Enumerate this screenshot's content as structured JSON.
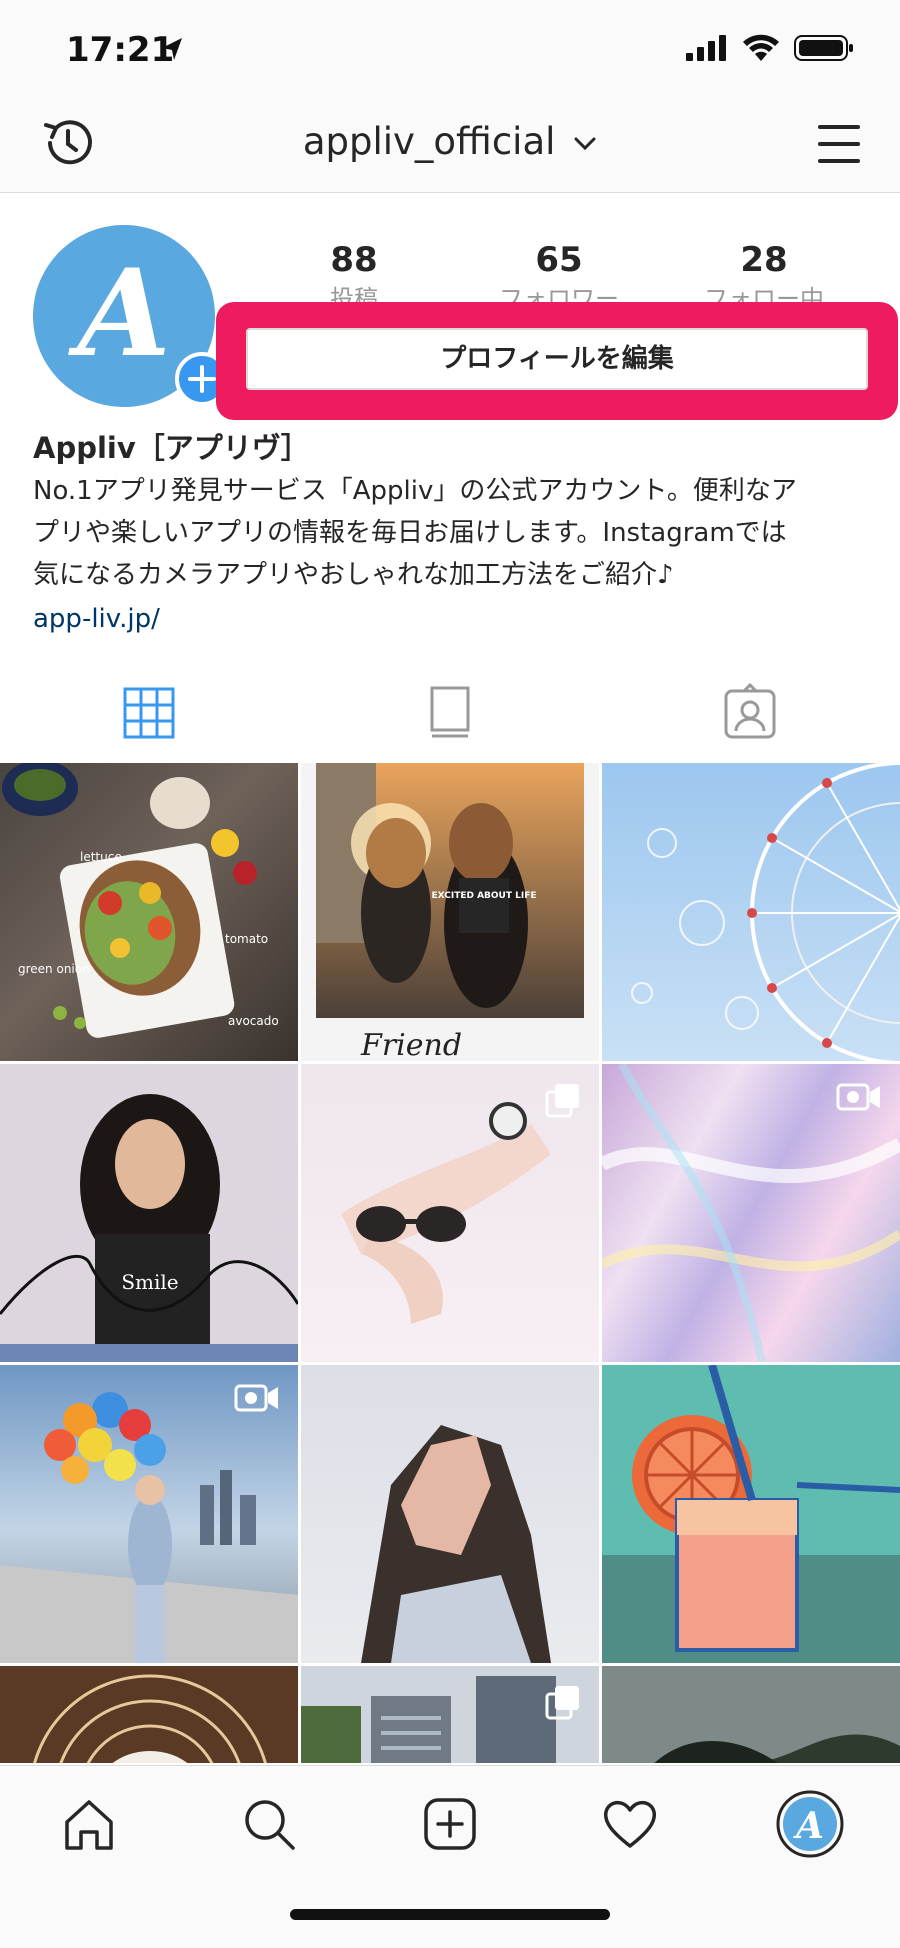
{
  "status_bar": {
    "time": "17:21"
  },
  "nav": {
    "username": "appliv_official"
  },
  "profile": {
    "avatar_letter": "A",
    "stats": [
      {
        "count": "88",
        "label": "投稿"
      },
      {
        "count": "65",
        "label": "フォロワー"
      },
      {
        "count": "28",
        "label": "フォロー中"
      }
    ],
    "edit_button_label": "プロフィールを編集",
    "highlight_color": "#ee1c5f",
    "name": "Appliv［アプリヴ］",
    "bio_lines": [
      "No.1アプリ発見サービス「Appliv」の公式アカウント。便利なア",
      "プリや楽しいアプリの情報を毎日お届けします。Instagramでは",
      "気になるカメラアプリやおしゃれな加工方法をご紹介♪"
    ],
    "link": "app-liv.jp/"
  },
  "tabs": [
    "grid-icon",
    "feed-icon",
    "tagged-icon"
  ],
  "posts": [
    {
      "alt": "food toast photo",
      "labels": [
        "lettuce",
        "tomato",
        "green onion",
        "avocado"
      ],
      "multi": ""
    },
    {
      "alt": "two girls friends photo",
      "labels": [
        "EXCITED ABOUT LIFE",
        "Friend"
      ],
      "multi": ""
    },
    {
      "alt": "ferris wheel bubbles photo",
      "labels": [],
      "multi": ""
    },
    {
      "alt": "girl with doodle photo",
      "labels": [
        "Smile"
      ],
      "multi": ""
    },
    {
      "alt": "hands with sunglasses photo",
      "labels": [],
      "multi": "carousel"
    },
    {
      "alt": "hologram texture photo",
      "labels": [],
      "multi": "video"
    },
    {
      "alt": "girl with balloons photo",
      "labels": [],
      "multi": "video"
    },
    {
      "alt": "girl low-poly portrait",
      "labels": [],
      "multi": ""
    },
    {
      "alt": "orange juice pixel art",
      "labels": [],
      "multi": ""
    },
    {
      "alt": "latte photo",
      "labels": [],
      "multi": ""
    },
    {
      "alt": "buildings photo",
      "labels": [],
      "multi": "carousel"
    },
    {
      "alt": "cave photo",
      "labels": [],
      "multi": ""
    }
  ],
  "colors": {
    "accent": "#3897f0",
    "link": "#003569",
    "text": "#262626",
    "muted": "#999999"
  }
}
